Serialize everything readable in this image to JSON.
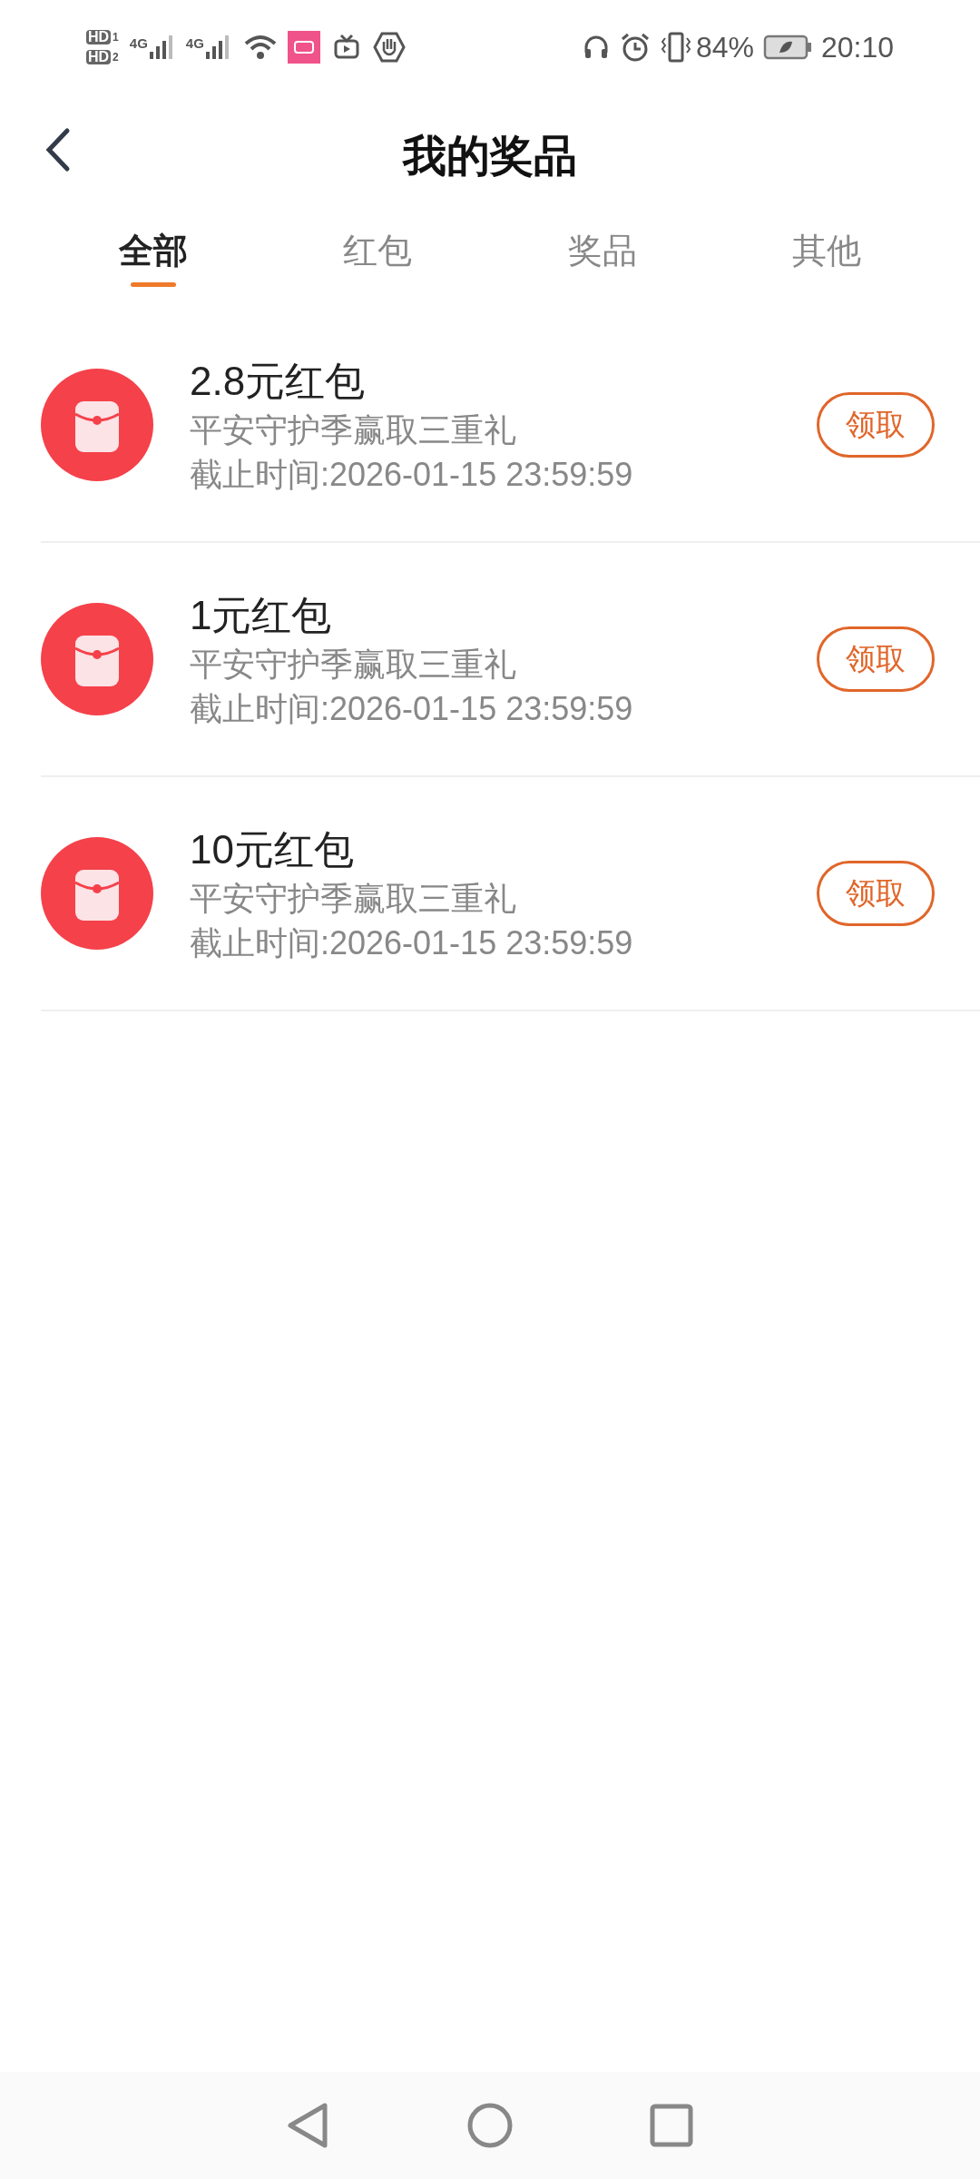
{
  "status_bar": {
    "sim_labels": [
      {
        "text": "HD",
        "slot": "1"
      },
      {
        "text": "HD",
        "slot": "2"
      }
    ],
    "networks": [
      "4G",
      "4G"
    ],
    "battery": "84%",
    "time": "20:10"
  },
  "header": {
    "title": "我的奖品"
  },
  "tabs": [
    {
      "label": "全部",
      "selected": true
    },
    {
      "label": "红包",
      "selected": false
    },
    {
      "label": "奖品",
      "selected": false
    },
    {
      "label": "其他",
      "selected": false
    }
  ],
  "prizes": [
    {
      "title": "2.8元红包",
      "subtitle": "平安守护季赢取三重礼",
      "deadline": "截止时间:2026-01-15 23:59:59",
      "action": "领取"
    },
    {
      "title": "1元红包",
      "subtitle": "平安守护季赢取三重礼",
      "deadline": "截止时间:2026-01-15 23:59:59",
      "action": "领取"
    },
    {
      "title": "10元红包",
      "subtitle": "平安守护季赢取三重礼",
      "deadline": "截止时间:2026-01-15 23:59:59",
      "action": "领取"
    }
  ]
}
